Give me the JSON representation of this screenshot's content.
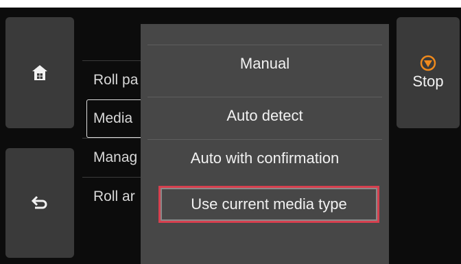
{
  "left_buttons": {
    "home_icon": "home-icon",
    "back_icon": "back-arrow-icon"
  },
  "stop_button": {
    "label": "Stop",
    "icon": "stop-icon",
    "color": "#f08a1c"
  },
  "background_list": {
    "items": [
      "Roll pa",
      "Media",
      "Manag",
      "Roll ar"
    ],
    "selected_index": 1
  },
  "popup": {
    "options": [
      "Manual",
      "Auto detect",
      "Auto with confirmation",
      "Use current media type"
    ],
    "highlighted_index": 3,
    "highlight_color": "#d6404f"
  }
}
